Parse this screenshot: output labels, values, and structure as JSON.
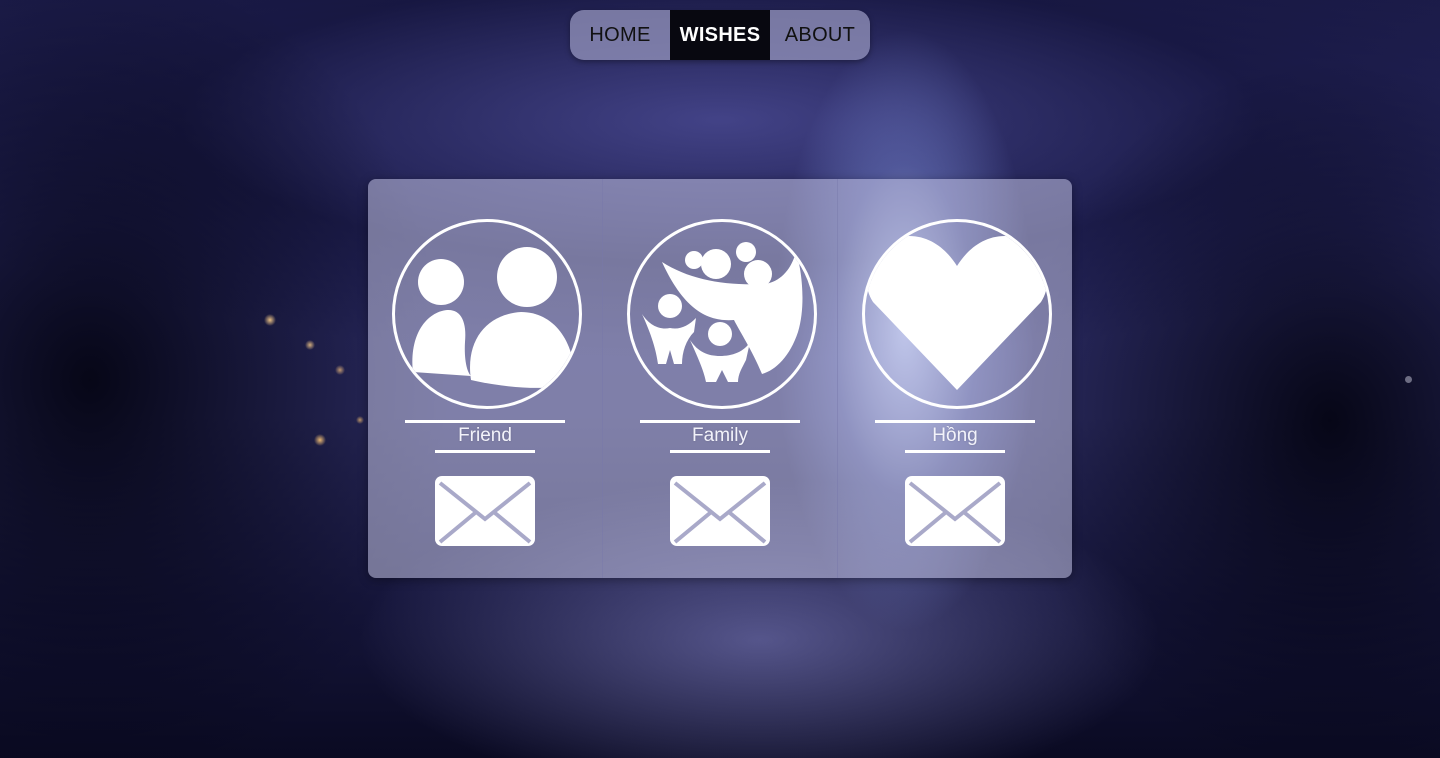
{
  "nav": {
    "items": [
      {
        "label": "HOME",
        "active": false
      },
      {
        "label": "WISHES",
        "active": true
      },
      {
        "label": "ABOUT",
        "active": false
      }
    ]
  },
  "cards": [
    {
      "label": "Friend",
      "icon": "friends-icon",
      "action_icon": "mail-icon"
    },
    {
      "label": "Family",
      "icon": "family-icon",
      "action_icon": "mail-icon"
    },
    {
      "label": "Hồng",
      "icon": "heart-icon",
      "action_icon": "mail-icon"
    }
  ],
  "colors": {
    "nav_active_bg": "#080810",
    "nav_bg": "#9696be",
    "icon_stroke": "#ffffff"
  }
}
